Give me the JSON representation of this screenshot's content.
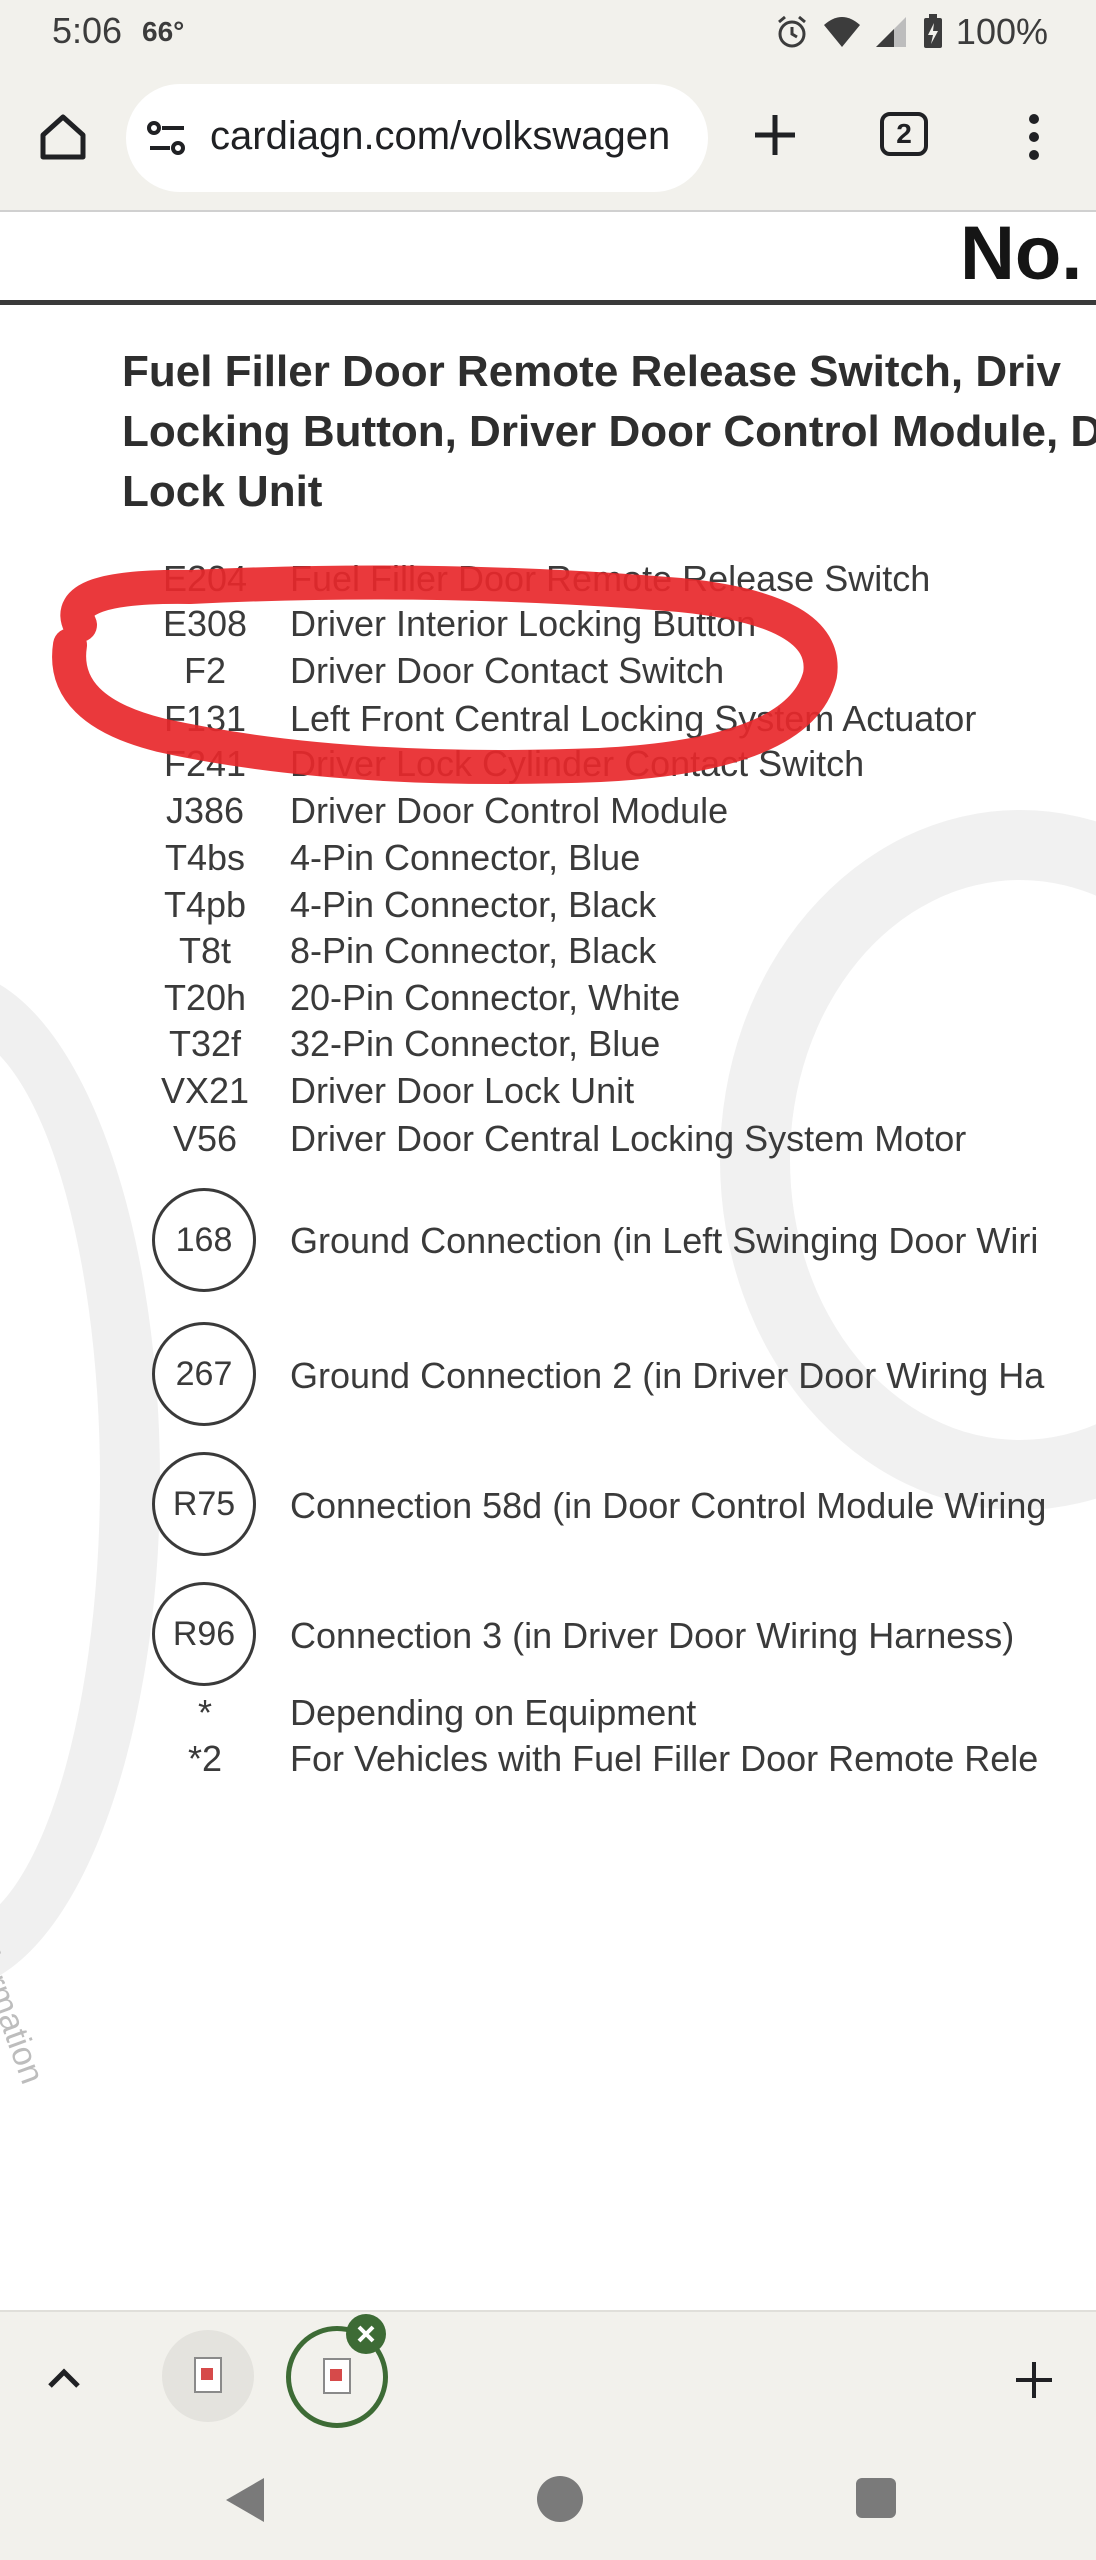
{
  "status_bar": {
    "time": "5:06",
    "temperature": "66°",
    "battery": "100%"
  },
  "browser": {
    "url": "cardiagn.com/volkswagen",
    "tab_count": "2"
  },
  "document": {
    "number_label": "No.",
    "heading_lines": [
      "Fuel Filler Door Remote Release Switch, Driv",
      "Locking Button, Driver Door Control Module, D",
      "Lock Unit"
    ],
    "watermark_text": "with respect to the correctness of information",
    "legend": [
      {
        "code": "E204",
        "description": "Fuel Filler Door Remote Release Switch"
      },
      {
        "code": "E308",
        "description": "Driver Interior Locking Button"
      },
      {
        "code": "F2",
        "description": "Driver Door Contact Switch"
      },
      {
        "code": "F131",
        "description": "Left Front Central Locking System Actuator"
      },
      {
        "code": "F241",
        "description": "Driver Lock Cylinder Contact Switch"
      },
      {
        "code": "J386",
        "description": "Driver Door Control Module"
      },
      {
        "code": "T4bs",
        "description": "4-Pin Connector, Blue"
      },
      {
        "code": "T4pb",
        "description": "4-Pin Connector, Black"
      },
      {
        "code": "T8t",
        "description": "8-Pin Connector, Black"
      },
      {
        "code": "T20h",
        "description": "20-Pin Connector, White"
      },
      {
        "code": "T32f",
        "description": "32-Pin Connector, Blue"
      },
      {
        "code": "VX21",
        "description": "Driver Door Lock Unit"
      },
      {
        "code": "V56",
        "description": "Driver Door Central Locking System Motor"
      }
    ],
    "connections": [
      {
        "code": "168",
        "description": "Ground Connection (in Left Swinging Door Wiri"
      },
      {
        "code": "267",
        "description": "Ground Connection 2 (in Driver Door Wiring Ha"
      },
      {
        "code": "R75",
        "description": "Connection 58d (in Door Control Module Wiring"
      },
      {
        "code": "R96",
        "description": "Connection 3 (in Driver Door Wiring Harness)"
      }
    ],
    "notes": [
      {
        "code": "*",
        "description": "Depending on Equipment"
      },
      {
        "code": "*2",
        "description": "For Vehicles with Fuel Filler Door Remote Rele"
      }
    ]
  },
  "annotation": {
    "marker_color": "#e8282b"
  },
  "colors": {
    "chrome_background": "#f2f1ec",
    "active_tab_ring": "#3d6b35"
  },
  "icons": {
    "home": "home-icon",
    "site_info": "tune-icon",
    "new_tab": "plus-icon",
    "menu": "more-vert-icon",
    "collapse": "chevron-up-icon"
  }
}
